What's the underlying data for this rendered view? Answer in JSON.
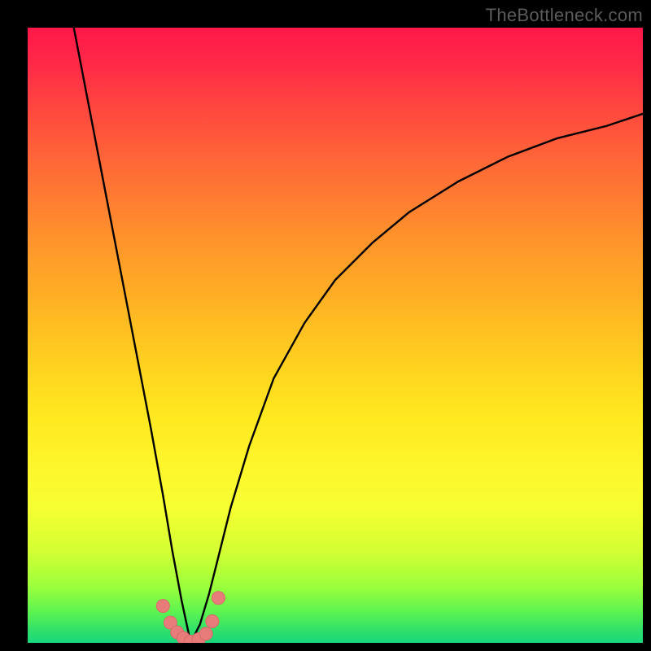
{
  "watermark": "TheBottleneck.com",
  "colors": {
    "frame": "#000000",
    "curve_stroke": "#000000",
    "marker_fill": "#e77c7b",
    "marker_stroke": "#d86a6a",
    "watermark": "#5b5b5b"
  },
  "chart_data": {
    "type": "line",
    "title": "",
    "xlabel": "",
    "ylabel": "",
    "xlim": [
      0,
      100
    ],
    "ylim": [
      0,
      100
    ],
    "grid": false,
    "legend": false,
    "note": "No axis ticks or numeric labels are rendered; values are estimated from pixel positions on a 0–100 scale for both axes. Curve resembles a V / bottleneck shape with its minimum near x≈26.5, y≈0.",
    "series": [
      {
        "name": "bottleneck-curve",
        "x": [
          7.5,
          10,
          12.5,
          15,
          17.5,
          20,
          22,
          23.5,
          25,
          26.5,
          28,
          29.5,
          31,
          33,
          36,
          40,
          45,
          50,
          56,
          62,
          70,
          78,
          86,
          94,
          100
        ],
        "y": [
          100,
          87,
          74,
          61,
          48,
          35,
          24,
          15,
          7,
          0,
          3,
          8,
          14,
          22,
          32,
          43,
          52,
          59,
          65,
          70,
          75,
          79,
          82,
          84,
          86
        ]
      }
    ],
    "markers": {
      "name": "highlight-points",
      "note": "Small salmon dots clustered around the curve minimum.",
      "x": [
        22.0,
        23.2,
        24.3,
        25.3,
        26.5,
        27.8,
        29.0,
        30.0,
        31.0
      ],
      "y": [
        6.0,
        3.3,
        1.7,
        0.8,
        0.2,
        0.6,
        1.5,
        3.5,
        7.3
      ]
    }
  }
}
